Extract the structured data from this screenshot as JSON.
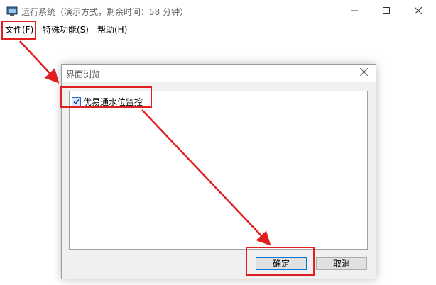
{
  "window": {
    "title": "运行系统（演示方式，剩余时间：58 分钟）"
  },
  "menubar": {
    "items": [
      {
        "label": "文件(F)"
      },
      {
        "label": "特殊功能(S)"
      },
      {
        "label": "帮助(H)"
      }
    ]
  },
  "dialog": {
    "title": "界面浏览",
    "tree_items": [
      {
        "label": "优易通水位监控",
        "checked": true
      }
    ],
    "ok_label": "确定",
    "cancel_label": "取消"
  },
  "colors": {
    "annotation_red": "#e02020",
    "checkbox_blue": "#2a6bd0",
    "ok_border": "#0078d7"
  },
  "icons": [
    "app-icon",
    "minimize-icon",
    "maximize-icon",
    "close-icon",
    "dialog-close-icon",
    "checked-checkbox-icon"
  ]
}
